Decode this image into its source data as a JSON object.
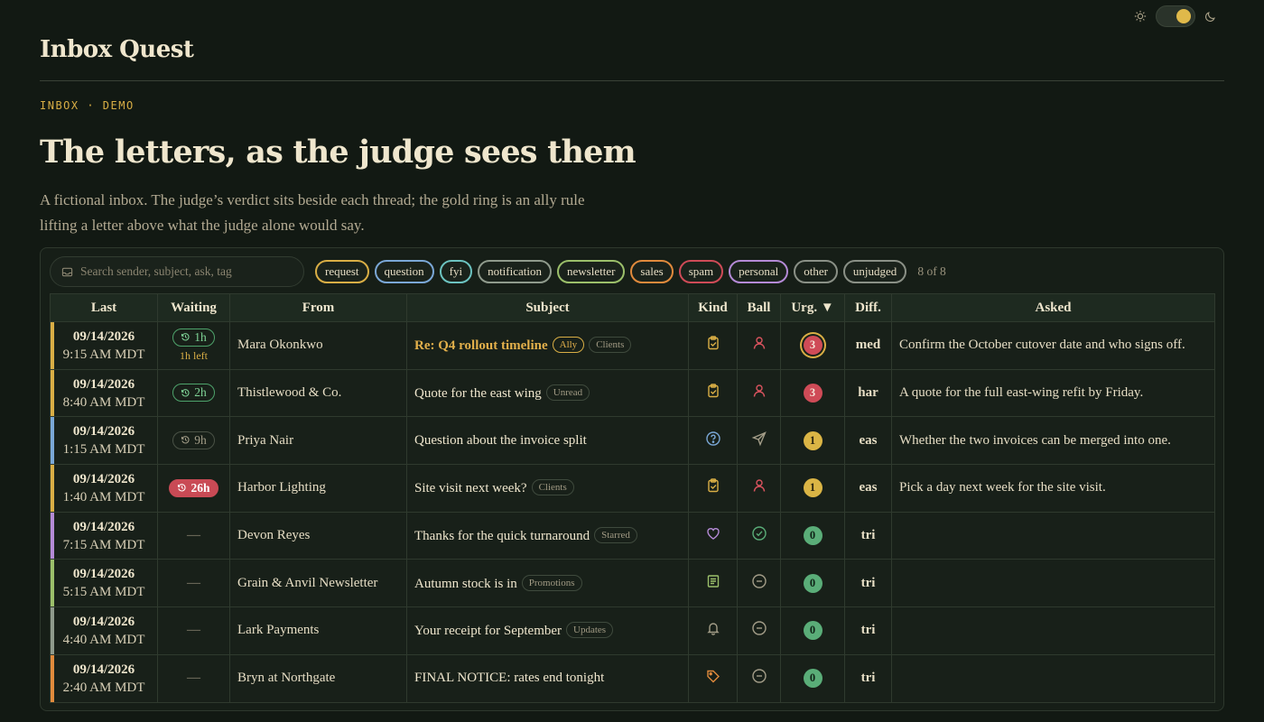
{
  "theme": {
    "mode": "dark",
    "accent": "#d9ae45"
  },
  "brand": "Inbox Quest",
  "eyebrow": "INBOX · DEMO",
  "headline": "The letters, as the judge sees them",
  "lede": "A fictional inbox. The judge’s verdict sits beside each thread; the gold ring is an ally rule lifting a letter above what the judge alone would say.",
  "search": {
    "placeholder": "Search sender, subject, ask, tag"
  },
  "filters": [
    {
      "label": "request",
      "color": "#d9ae45"
    },
    {
      "label": "question",
      "color": "#7aa7d6"
    },
    {
      "label": "fyi",
      "color": "#6cc3c0"
    },
    {
      "label": "notification",
      "color": "#8f9a8c"
    },
    {
      "label": "newsletter",
      "color": "#9bbf6a"
    },
    {
      "label": "sales",
      "color": "#e08a3c"
    },
    {
      "label": "spam",
      "color": "#cf4b57"
    },
    {
      "label": "personal",
      "color": "#b48ad6"
    },
    {
      "label": "other",
      "color": "#8a9086"
    },
    {
      "label": "unjudged",
      "color": "#8a9086"
    }
  ],
  "count": "8 of 8",
  "columns": {
    "last": "Last",
    "waiting": "Waiting",
    "from": "From",
    "subject": "Subject",
    "kind": "Kind",
    "ball": "Ball",
    "urgency": "Urg. ▼",
    "difficulty": "Diff.",
    "asked": "Asked"
  },
  "rows": [
    {
      "date": "09/14/2026",
      "time": "9:15 AM MDT",
      "stripe": "#d9ae45",
      "wait": "1h",
      "wait_style": "green",
      "wait_left": "1h left",
      "from": "Mara Okonkwo",
      "subject": "Re: Q4 rollout timeline",
      "subject_hl": true,
      "tags": [
        "Ally",
        "Clients"
      ],
      "kind": "clipboard-check",
      "kind_color": "#d9ae45",
      "ball": "person",
      "ball_color": "#d9535e",
      "urgency": "3",
      "urg_style": "red",
      "ring": true,
      "difficulty": "med",
      "asked": "Confirm the October cutover date and who signs off."
    },
    {
      "date": "09/14/2026",
      "time": "8:40 AM MDT",
      "stripe": "#d9ae45",
      "wait": "2h",
      "wait_style": "green",
      "wait_left": "",
      "from": "Thistlewood & Co.",
      "subject": "Quote for the east wing",
      "subject_hl": false,
      "tags": [
        "Unread"
      ],
      "kind": "clipboard-check",
      "kind_color": "#d9ae45",
      "ball": "person",
      "ball_color": "#d9535e",
      "urgency": "3",
      "urg_style": "red",
      "ring": false,
      "difficulty": "har",
      "asked": "A quote for the full east-wing refit by Friday."
    },
    {
      "date": "09/14/2026",
      "time": "1:15 AM MDT",
      "stripe": "#7aa7d6",
      "wait": "9h",
      "wait_style": "grey",
      "wait_left": "",
      "from": "Priya Nair",
      "subject": "Question about the invoice split",
      "subject_hl": false,
      "tags": [],
      "kind": "question-circle",
      "kind_color": "#7aa7d6",
      "ball": "send",
      "ball_color": "#a39d88",
      "urgency": "1",
      "urg_style": "gold",
      "ring": false,
      "difficulty": "eas",
      "asked": "Whether the two invoices can be merged into one."
    },
    {
      "date": "09/14/2026",
      "time": "1:40 AM MDT",
      "stripe": "#d9ae45",
      "wait": "26h",
      "wait_style": "red",
      "wait_left": "",
      "from": "Harbor Lighting",
      "subject": "Site visit next week?",
      "subject_hl": false,
      "tags": [
        "Clients"
      ],
      "kind": "clipboard-check",
      "kind_color": "#d9ae45",
      "ball": "person",
      "ball_color": "#d9535e",
      "urgency": "1",
      "urg_style": "gold",
      "ring": false,
      "difficulty": "eas",
      "asked": "Pick a day next week for the site visit."
    },
    {
      "date": "09/14/2026",
      "time": "7:15 AM MDT",
      "stripe": "#b48ad6",
      "wait": "—",
      "wait_style": "none",
      "wait_left": "",
      "from": "Devon Reyes",
      "subject": "Thanks for the quick turnaround",
      "subject_hl": false,
      "tags": [
        "Starred"
      ],
      "kind": "heart",
      "kind_color": "#b48ad6",
      "ball": "check-circle",
      "ball_color": "#5aad78",
      "urgency": "0",
      "urg_style": "green",
      "ring": false,
      "difficulty": "tri",
      "asked": ""
    },
    {
      "date": "09/14/2026",
      "time": "5:15 AM MDT",
      "stripe": "#9bbf6a",
      "wait": "—",
      "wait_style": "none",
      "wait_left": "",
      "from": "Grain & Anvil Newsletter",
      "subject": "Autumn stock is in",
      "subject_hl": false,
      "tags": [
        "Promotions"
      ],
      "kind": "newspaper",
      "kind_color": "#9bbf6a",
      "ball": "minus-circle",
      "ball_color": "#a39d88",
      "urgency": "0",
      "urg_style": "green",
      "ring": false,
      "difficulty": "tri",
      "asked": ""
    },
    {
      "date": "09/14/2026",
      "time": "4:40 AM MDT",
      "stripe": "#8f9a8c",
      "wait": "—",
      "wait_style": "none",
      "wait_left": "",
      "from": "Lark Payments",
      "subject": "Your receipt for September",
      "subject_hl": false,
      "tags": [
        "Updates"
      ],
      "kind": "bell",
      "kind_color": "#a39d88",
      "ball": "minus-circle",
      "ball_color": "#a39d88",
      "urgency": "0",
      "urg_style": "green",
      "ring": false,
      "difficulty": "tri",
      "asked": ""
    },
    {
      "date": "09/14/2026",
      "time": "2:40 AM MDT",
      "stripe": "#e08a3c",
      "wait": "—",
      "wait_style": "none",
      "wait_left": "",
      "from": "Bryn at Northgate",
      "subject": "FINAL NOTICE: rates end tonight",
      "subject_hl": false,
      "tags": [],
      "kind": "tag",
      "kind_color": "#e08a3c",
      "ball": "minus-circle",
      "ball_color": "#a39d88",
      "urgency": "0",
      "urg_style": "green",
      "ring": false,
      "difficulty": "tri",
      "asked": ""
    }
  ]
}
